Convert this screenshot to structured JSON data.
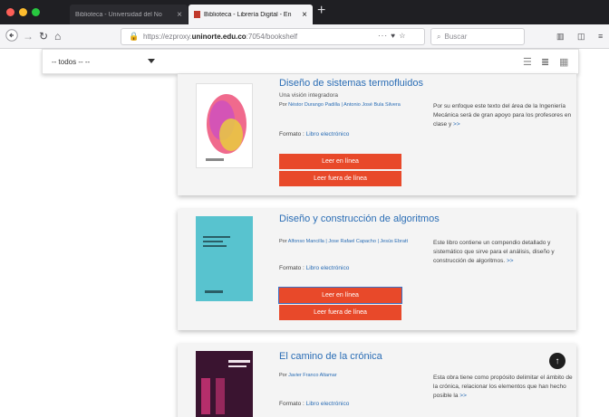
{
  "browser": {
    "tabs": [
      {
        "label": "Biblioteca - Universidad del No",
        "close": "×"
      },
      {
        "label": "Biblioteca - Librería Digital - En",
        "close": "×"
      }
    ],
    "new_tab": "+",
    "url_prefix": "https://ezproxy.",
    "url_domain": "uninorte.edu.co",
    "url_suffix": ":7054/bookshelf",
    "url_extras": "··· ♥ ☆",
    "search_placeholder": "Buscar"
  },
  "filter": {
    "selected": "-- todos -- --"
  },
  "books": [
    {
      "title": "Diseño de sistemas termofluidos",
      "subtitle": "Una visión integradora",
      "por": "Por",
      "authors": "Néstor Durango Padilla | Antonio José Bula Silvera",
      "format_label": "Formato :",
      "format_value": "Libro electrónico",
      "read_online": "Leer en línea",
      "read_offline": "Leer fuera de línea",
      "description": "Por su enfoque este texto del área de la Ingeniería Mecánica será de gran apoyo para los profesores en clase y",
      "more": ">>",
      "cover_colors": [
        "#f06a8d",
        "#c74cc8",
        "#e9d23a"
      ]
    },
    {
      "title": "Diseño y construcción de algoritmos",
      "subtitle": "",
      "por": "Por",
      "authors": "Alfonso Mancilla | Jose Rafael Capacho | Jesús Ebratt",
      "format_label": "Formato :",
      "format_value": "Libro electrónico",
      "read_online": "Leer en línea",
      "read_offline": "Leer fuera de línea",
      "description": "Este libro contiene un compendio detallado y sistemático que sirve para el análisis, diseño y construcción de algoritmos.",
      "more": ">>",
      "cover_colors": [
        "#58c3cf"
      ]
    },
    {
      "title": "El camino de la crónica",
      "subtitle": "",
      "por": "Por",
      "authors": "Javier Franco Altamar",
      "format_label": "Formato :",
      "format_value": "Libro electrónico",
      "description": "Esta obra tiene como propósito delimitar el ámbito de la crónica, relacionar los elementos que han hecho posible la",
      "more": ">>",
      "cover_colors": [
        "#3a1430",
        "#d4357a"
      ]
    }
  ],
  "scroll_top_icon": "↑",
  "colors": {
    "accent_button": "#e8492a",
    "link": "#2a6db5"
  }
}
